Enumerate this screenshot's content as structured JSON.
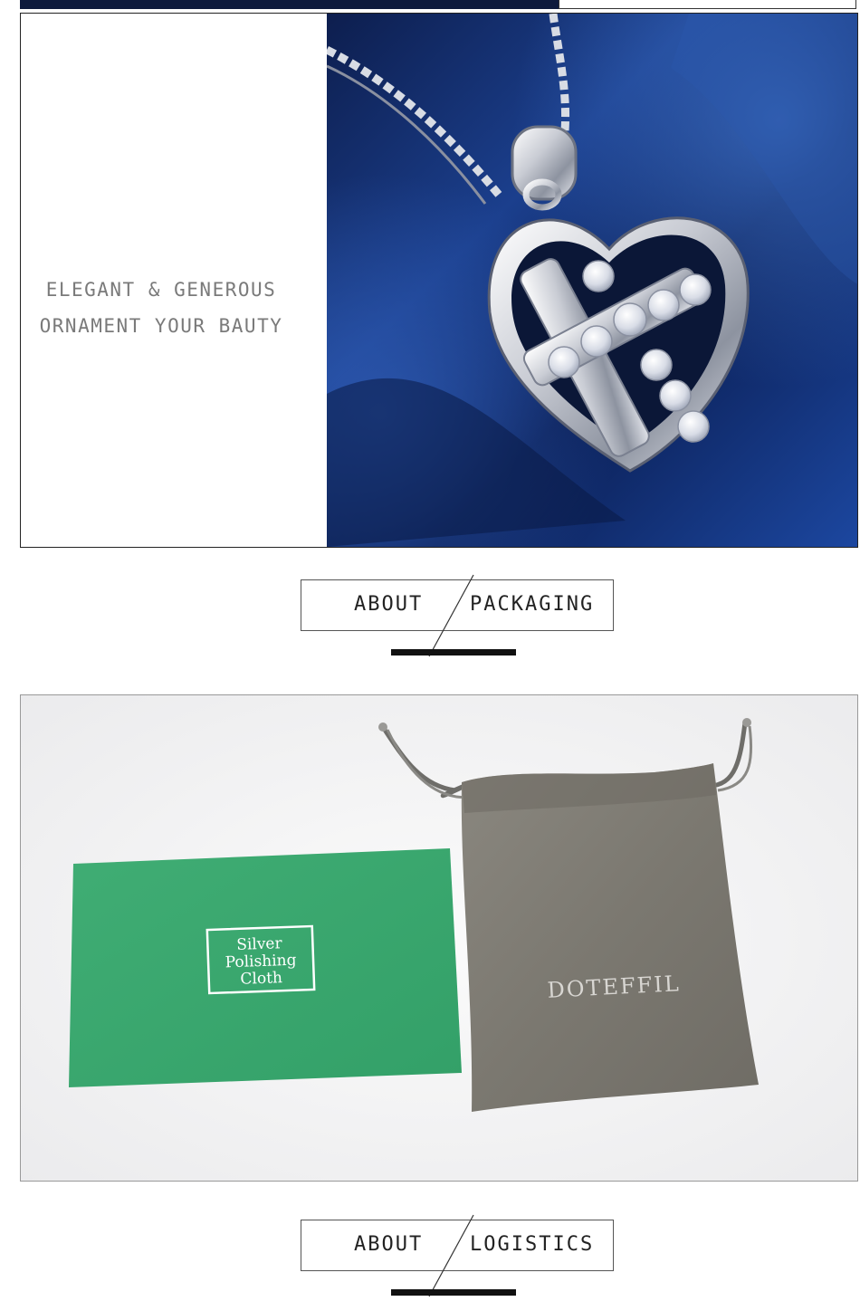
{
  "ornament": {
    "slogan_line_1": "ELEGANT & GENEROUS",
    "slogan_line_2": "ORNAMENT YOUR BAUTY",
    "photo_subject": "heart-cross-pendant-necklace"
  },
  "packaging_header": {
    "left": "ABOUT",
    "right": "PACKAGING"
  },
  "packaging": {
    "card_label": [
      "Silver",
      "Polishing",
      "Cloth"
    ],
    "pouch_brand": "DOTEFFIL"
  },
  "logistics_header": {
    "left": "ABOUT",
    "right": "LOGISTICS"
  },
  "colors": {
    "satin_blue": "#10306e",
    "card_green": "#3aa56e",
    "pouch_gray": "#7c7a72",
    "text_gray": "#7a7a7a"
  }
}
